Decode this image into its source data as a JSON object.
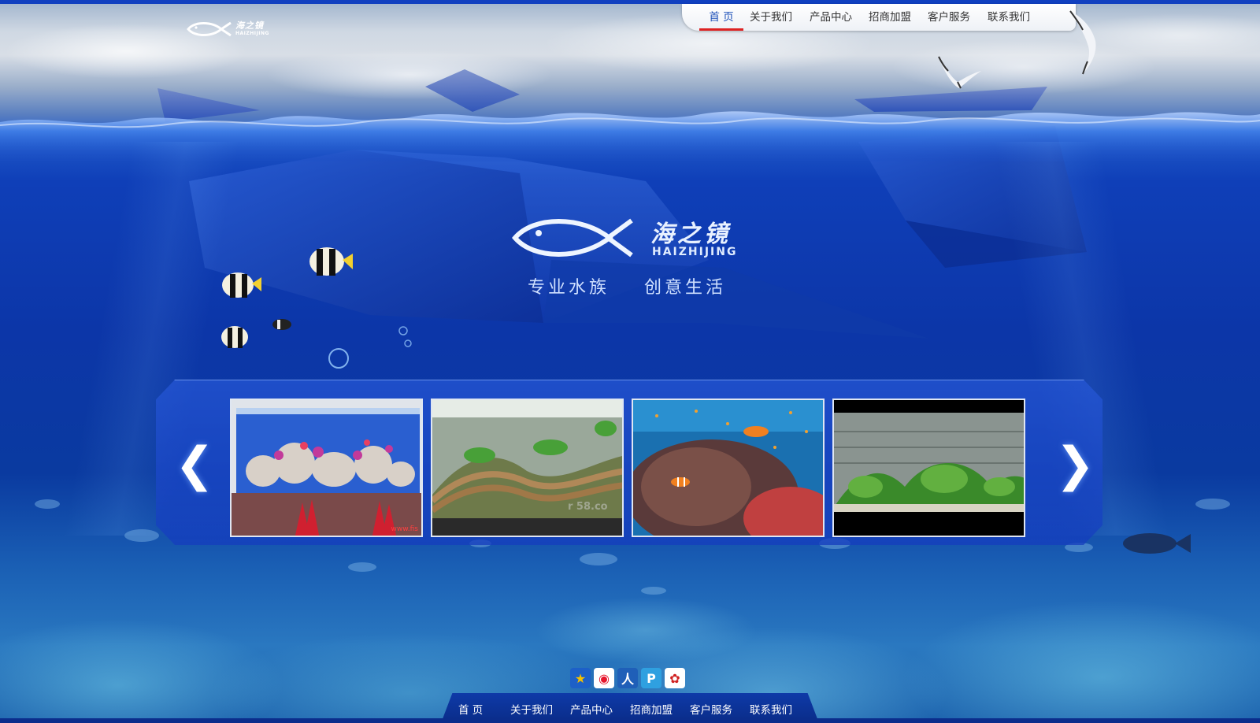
{
  "header": {
    "logo_cn": "海之镜",
    "logo_en": "HAIZHIJING",
    "nav": [
      {
        "label": "首 页",
        "active": true
      },
      {
        "label": "关于我们",
        "active": false
      },
      {
        "label": "产品中心",
        "active": false
      },
      {
        "label": "招商加盟",
        "active": false
      },
      {
        "label": "客户服务",
        "active": false
      },
      {
        "label": "联系我们",
        "active": false
      }
    ]
  },
  "hero": {
    "brand_cn": "海之镜",
    "brand_en": "HAIZHIJING",
    "slogan_left": "专业水族",
    "slogan_right": "创意生活"
  },
  "carousel": {
    "prev_label": "❮",
    "next_label": "❯",
    "thumbs": [
      {
        "name": "marine-reef-tank",
        "caption": "www.fis"
      },
      {
        "name": "planted-terrace-tank",
        "watermark": "r 58.co"
      },
      {
        "name": "coral-reef-clownfish"
      },
      {
        "name": "planted-aquascape"
      }
    ]
  },
  "social": [
    {
      "name": "qzone-icon",
      "glyph": "★",
      "color": "#f5c000"
    },
    {
      "name": "weibo-icon",
      "glyph": "◉",
      "color": "#e6162d"
    },
    {
      "name": "renren-icon",
      "glyph": "人",
      "color": "#1f5fb8"
    },
    {
      "name": "pengyou-icon",
      "glyph": "P",
      "color": "#2fa0e0"
    },
    {
      "name": "kaixin-icon",
      "glyph": "✿",
      "color": "#d02020"
    }
  ],
  "footer": {
    "nav": [
      "首 页",
      "关于我们",
      "产品中心",
      "招商加盟",
      "客户服务",
      "联系我们"
    ]
  },
  "colors": {
    "accent": "#1b4fb8",
    "active_underline": "#dd2222",
    "deep_blue": "#0c36a8"
  }
}
